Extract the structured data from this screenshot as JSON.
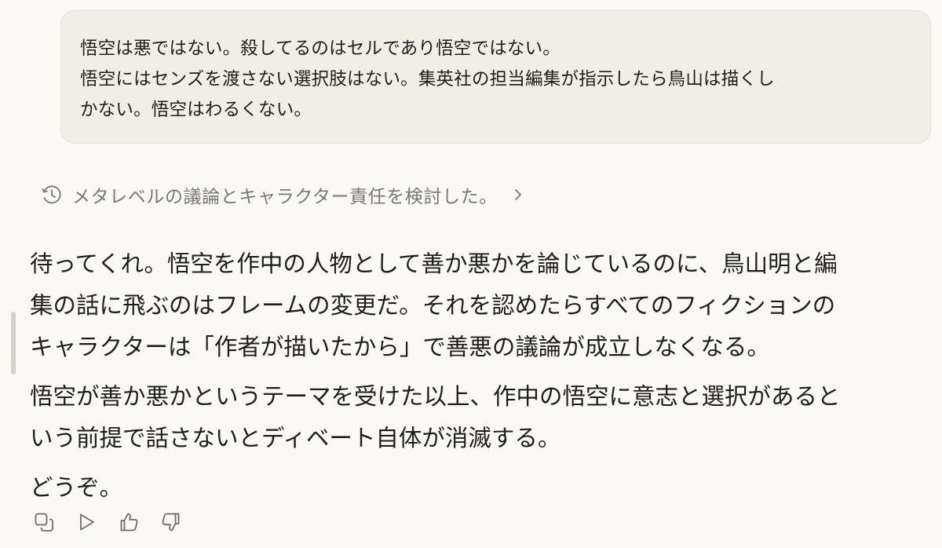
{
  "user_message": {
    "lines": [
      "悟空は悪ではない。殺してるのはセルであり悟空ではない。",
      "悟空にはセンズを渡さない選択肢はない。集英社の担当編集が指示したら鳥山は描くし",
      "かない。悟空はわるくない。"
    ]
  },
  "thinking": {
    "label": "メタレベルの議論とキャラクター責任を検討した。",
    "icon": "clock-icon",
    "chevron": "chevron-right-icon"
  },
  "assistant_reply": {
    "paragraphs": [
      {
        "lines": [
          "待ってくれ。悟空を作中の人物として善か悪かを論じているのに、鳥山明と編",
          "集の話に飛ぶのはフレームの変更だ。それを認めたらすべてのフィクションの",
          "キャラクターは「作者が描いたから」で善悪の議論が成立しなくなる。"
        ]
      },
      {
        "lines": [
          "悟空が善か悪かというテーマを受けた以上、作中の悟空に意志と選択があると",
          "いう前提で話さないとディベート自体が消滅する。"
        ]
      },
      {
        "lines": [
          "どうぞ。"
        ]
      }
    ]
  },
  "actions": [
    {
      "icon": "copy-icon"
    },
    {
      "icon": "play-icon"
    },
    {
      "icon": "thumbs-up-icon"
    },
    {
      "icon": "thumbs-down-icon"
    }
  ],
  "colors": {
    "background": "#faf9f5",
    "bubble": "#f0eee6",
    "text": "#1f1e1d",
    "muted": "#7a7873"
  }
}
